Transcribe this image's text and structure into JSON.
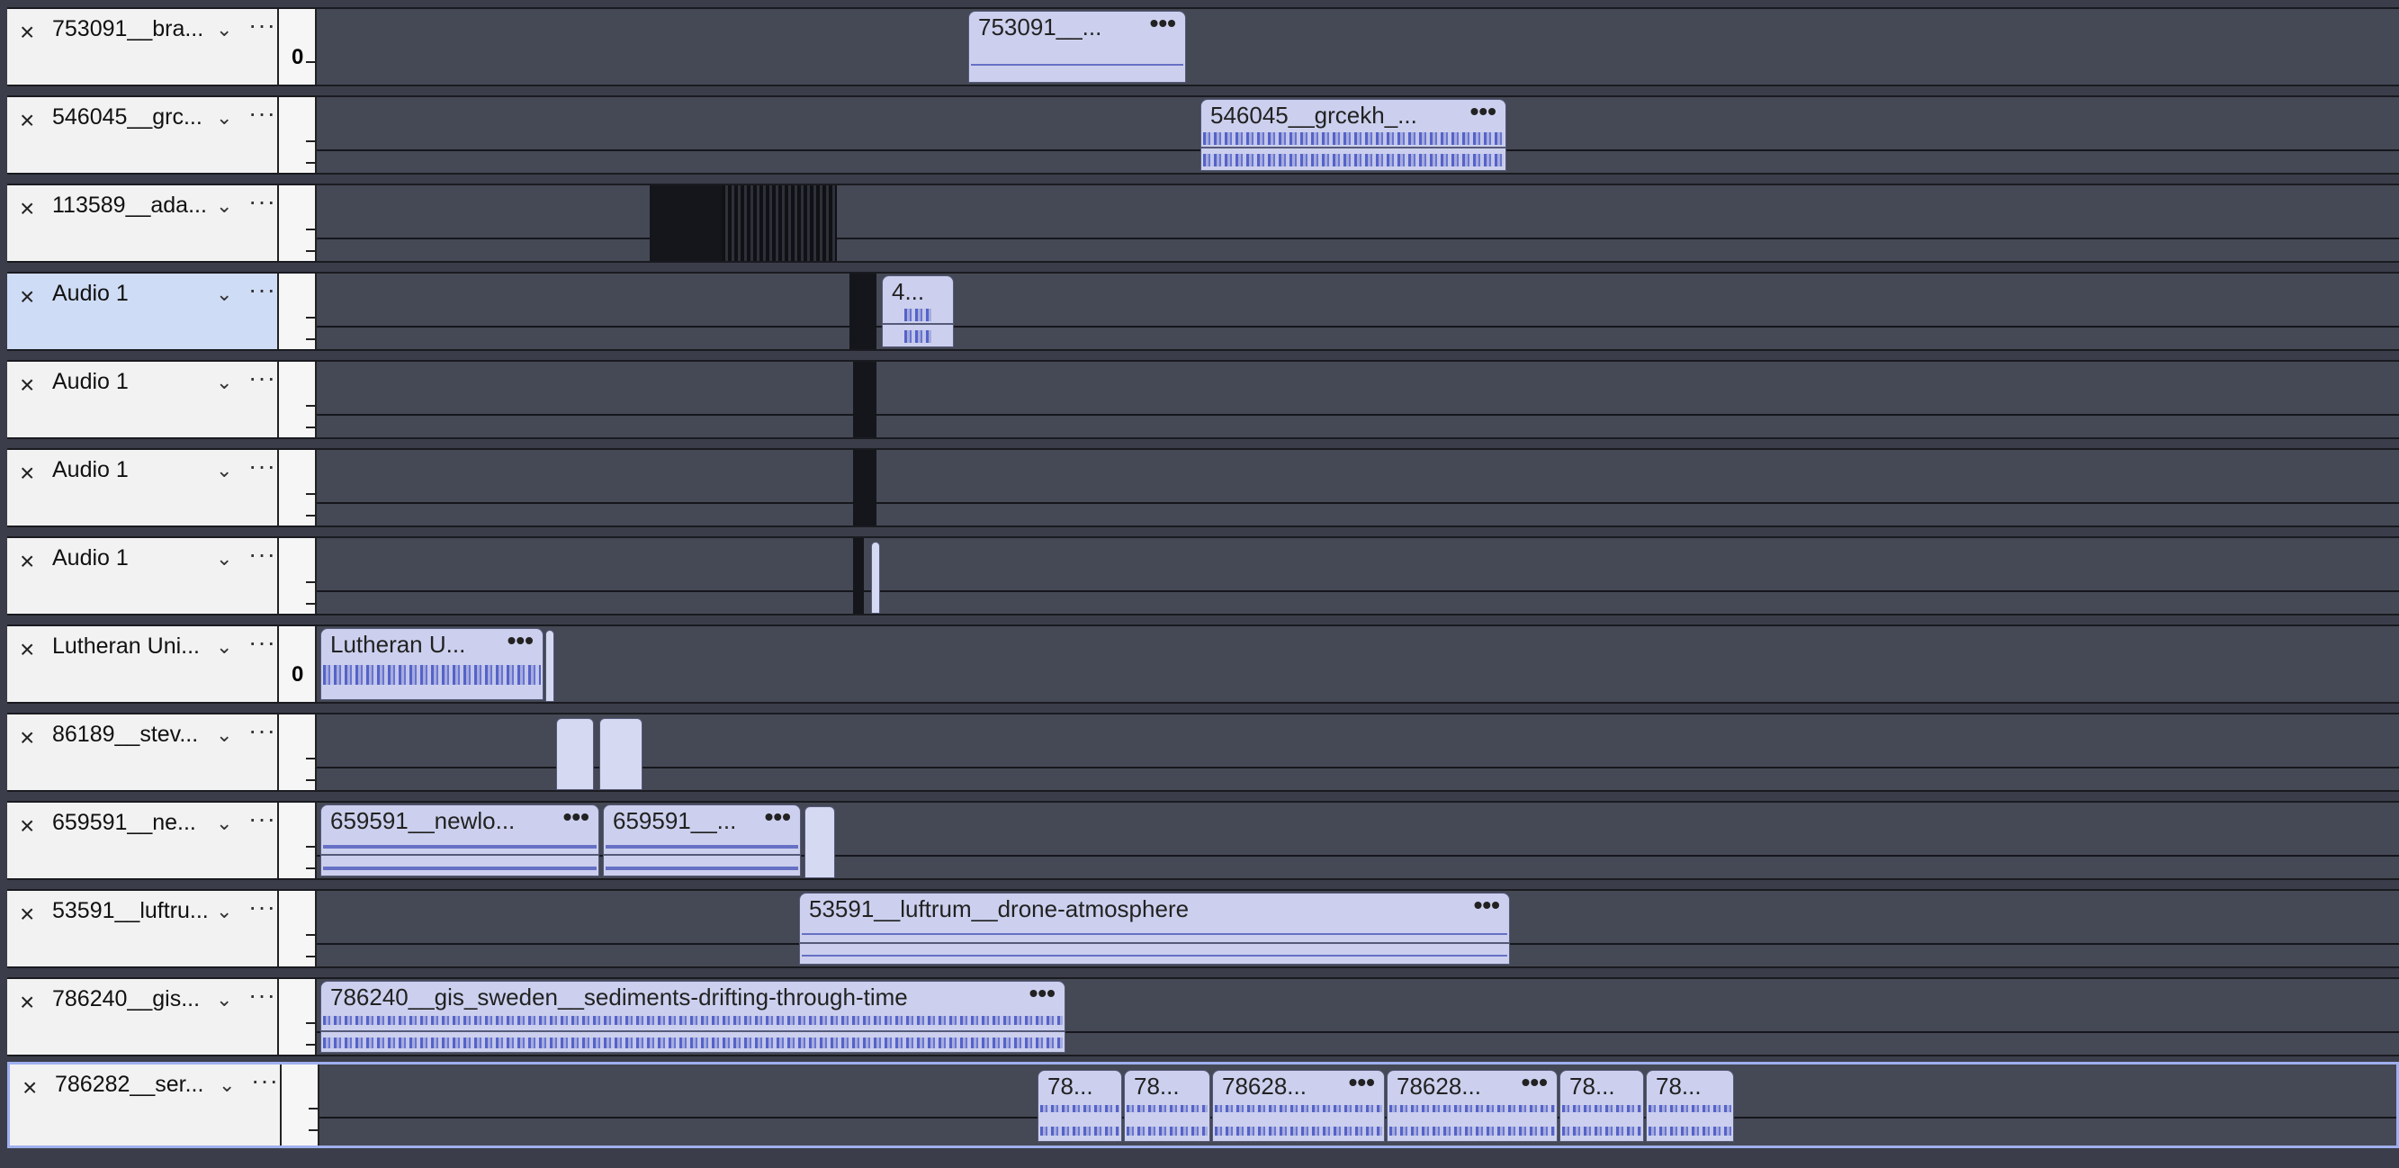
{
  "colors": {
    "lane_background": "#454855",
    "header_background": "#f2f2f2",
    "selected_header": "#cfdcf5",
    "clip_fill": "#ccd0ee",
    "waveform": "#5562c8",
    "selection_border": "#9fb0ee"
  },
  "icons": {
    "close": "×",
    "menu": "⌄",
    "more": "···"
  },
  "tracks": [
    {
      "name": "753091__bra...",
      "clips": [
        {
          "title": "753091__...",
          "more": "•••"
        }
      ]
    },
    {
      "name": "546045__grc...",
      "clips": [
        {
          "title": "546045__grcekh_...",
          "more": "•••"
        }
      ]
    },
    {
      "name": "113589__ada...",
      "clips": []
    },
    {
      "name": "Audio 1",
      "clips": [
        {
          "title": "4...",
          "more": ""
        }
      ]
    },
    {
      "name": "Audio 1",
      "clips": []
    },
    {
      "name": "Audio 1",
      "clips": []
    },
    {
      "name": "Audio 1",
      "clips": []
    },
    {
      "name": "Lutheran Uni...",
      "clips": [
        {
          "title": "Lutheran U...",
          "more": "•••"
        }
      ]
    },
    {
      "name": "86189__stev...",
      "clips": []
    },
    {
      "name": "659591__ne...",
      "clips": [
        {
          "title": "659591__newlo...",
          "more": "•••"
        },
        {
          "title": "659591__...",
          "more": "•••"
        }
      ]
    },
    {
      "name": "53591__luftru...",
      "clips": [
        {
          "title": "53591__luftrum__drone-atmosphere",
          "more": "•••"
        }
      ]
    },
    {
      "name": "786240__gis...",
      "clips": [
        {
          "title": "786240__gis_sweden__sediments-drifting-through-time",
          "more": "•••"
        }
      ]
    },
    {
      "name": "786282__ser...",
      "clips": [
        {
          "title": "78...",
          "more": ""
        },
        {
          "title": "78...",
          "more": ""
        },
        {
          "title": "78628...",
          "more": "•••"
        },
        {
          "title": "78628...",
          "more": "•••"
        },
        {
          "title": "78...",
          "more": ""
        },
        {
          "title": "78...",
          "more": ""
        }
      ]
    }
  ],
  "ruler_zero": "0"
}
